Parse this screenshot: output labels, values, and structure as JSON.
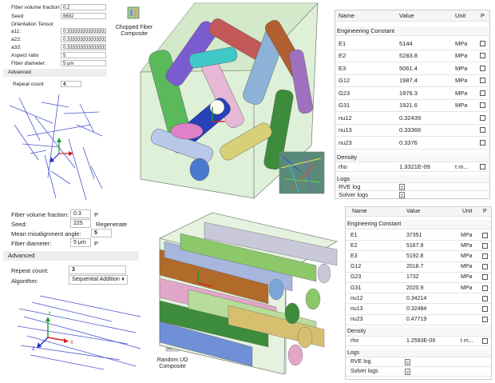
{
  "top_panel": {
    "fields": [
      {
        "label": "Fiber volume fraction",
        "value": "0.2"
      },
      {
        "label": "Seed",
        "value": "6692"
      },
      {
        "label": "Orientation Tensor",
        "value": null
      },
      {
        "label": "a11:",
        "value": "0.333333333333333"
      },
      {
        "label": "a22:",
        "value": "0.333333333333333"
      },
      {
        "label": "a33:",
        "value": "0.333333333333333"
      },
      {
        "label": "Aspect ratio",
        "value": "5"
      },
      {
        "label": "Fiber diameter:",
        "value": "5 µm"
      }
    ],
    "advanced_label": "Advanced",
    "repeat_label": "Repeat count",
    "repeat_value": "4",
    "button_label": "Chopped Fiber Composite"
  },
  "bottom_panel": {
    "fields": [
      {
        "label": "Fiber volume fraction:",
        "value": "0.3",
        "suffix": "P"
      },
      {
        "label": "Seed:",
        "value": "225",
        "suffix": "Regenerate"
      },
      {
        "label": "Mean misalignment angle:",
        "value": "5",
        "suffix": ""
      },
      {
        "label": "Fiber diameter:",
        "value": "5 µm",
        "suffix": "P"
      }
    ],
    "advanced_label": "Advanced",
    "repeat_label": "Repeat count:",
    "repeat_value": "3",
    "algorithm_label": "Algorithm:",
    "algorithm_value": "Sequential Addition",
    "button_label": "Random UD Composite"
  },
  "table_top": {
    "headers": {
      "name": "Name",
      "value": "Value",
      "unit": "Unit",
      "p": "P"
    },
    "group_engineering": "Engineering Constant",
    "rows": [
      {
        "name": "E1",
        "value": "5144",
        "unit": "MPa"
      },
      {
        "name": "E2",
        "value": "5283.8",
        "unit": "MPa"
      },
      {
        "name": "E3",
        "value": "5061.4",
        "unit": "MPa"
      },
      {
        "name": "G12",
        "value": "1987.4",
        "unit": "MPa"
      },
      {
        "name": "G23",
        "value": "1976.3",
        "unit": "MPa"
      },
      {
        "name": "G31",
        "value": "1921.6",
        "unit": "MPa"
      },
      {
        "name": "nu12",
        "value": "0.32439",
        "unit": ""
      },
      {
        "name": "nu13",
        "value": "0.33366",
        "unit": ""
      },
      {
        "name": "nu23",
        "value": "0.3376",
        "unit": ""
      }
    ],
    "group_density": "Density",
    "density": {
      "name": "rho",
      "value": "1.3321E-09",
      "unit": "t m..."
    },
    "group_logs": "Logs",
    "logs": [
      "RVE log",
      "Solver logs"
    ]
  },
  "table_bottom": {
    "headers": {
      "name": "Name",
      "value": "Value",
      "unit": "Unit",
      "p": "P"
    },
    "group_engineering": "Engineering Constant",
    "rows": [
      {
        "name": "E1",
        "value": "37351",
        "unit": "MPa"
      },
      {
        "name": "E2",
        "value": "5167.9",
        "unit": "MPa"
      },
      {
        "name": "E3",
        "value": "5192.8",
        "unit": "MPa"
      },
      {
        "name": "G12",
        "value": "2018.7",
        "unit": "MPa"
      },
      {
        "name": "G23",
        "value": "1732",
        "unit": "MPa"
      },
      {
        "name": "G31",
        "value": "2020.9",
        "unit": "MPa"
      },
      {
        "name": "nu12",
        "value": "0.34214",
        "unit": ""
      },
      {
        "name": "nu13",
        "value": "0.32484",
        "unit": ""
      },
      {
        "name": "nu23",
        "value": "0.47719",
        "unit": ""
      }
    ],
    "group_density": "Density",
    "density": {
      "name": "rho",
      "value": "1.2593E-09",
      "unit": "t m..."
    },
    "group_logs": "Logs",
    "logs": [
      "RVE log",
      "Solver logs"
    ]
  },
  "axis_labels": {
    "x": "X",
    "y": "Y",
    "z": "Z"
  },
  "colors": {
    "panel_bg": "#eceef1",
    "border": "#c8ccd2",
    "fiber_line": "#4a55d0",
    "box_edge": "#7d8a7d"
  }
}
